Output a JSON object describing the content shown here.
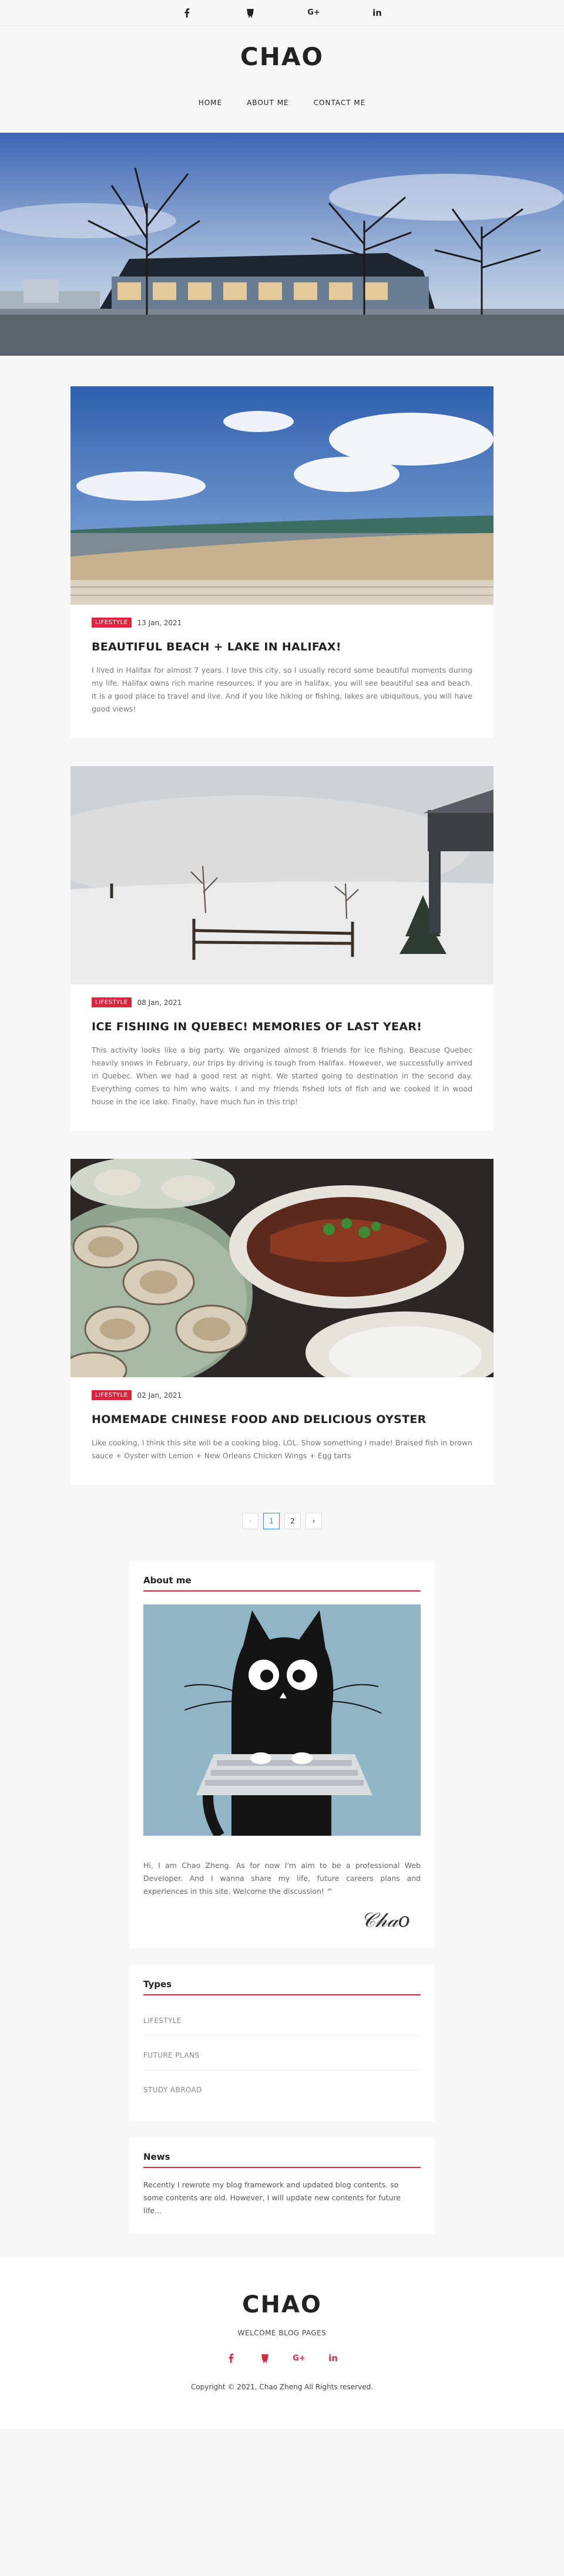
{
  "social": {
    "facebook_icon": "facebook-icon",
    "github_icon": "github-icon",
    "googleplus_icon": "google-plus-icon",
    "linkedin_icon": "linkedin-icon",
    "googleplus_text": "G+",
    "linkedin_text": "in"
  },
  "header": {
    "brand": "CHAO",
    "nav": [
      "HOME",
      "ABOUT ME",
      "CONTACT ME"
    ]
  },
  "posts": [
    {
      "category": "LIFESTYLE",
      "date": "13 Jan, 2021",
      "title": "BEAUTIFUL BEACH + LAKE IN HALIFAX!",
      "excerpt": "I lived in Halifax for almost 7 years. I love this city, so I usually record some beautiful moments during my life. Halifax owns rich marine resources, if you are in halifax, you will see beautiful sea and beach. It is a good place to travel and live. And if you like hiking or fishing, lakes are ubiquitous, you will have good views!"
    },
    {
      "category": "LIFESTYLE",
      "date": "08 Jan, 2021",
      "title": "ICE FISHING IN QUEBEC! MEMORIES OF LAST YEAR!",
      "excerpt": "This activity looks like a big party. We organized almost 8 friends for ice fishing. Beacuse Quebec heavily snows in February, our trips by driving is tough from Halifax. However, we successfully arrived in Quebec. When we had a good rest at night. We started going to destination in the second day. Everything comes to him who waits. I and my friends fished lots of fish and we cooked it in wood house in the ice lake. Finally, have much fun in this trip!"
    },
    {
      "category": "LIFESTYLE",
      "date": "02 Jan, 2021",
      "title": "HOMEMADE CHINESE FOOD AND DELICIOUS OYSTER",
      "excerpt": "Like cooking, I think this site will be a cooking blog. LOL. Show something I made! Braised fish in brown sauce + Oyster with Lemon + New Orleans Chicken Wings + Egg tarts"
    }
  ],
  "pagination": {
    "prev": "‹",
    "pages": [
      "1",
      "2"
    ],
    "next": "›",
    "active": "1"
  },
  "about": {
    "title": "About me",
    "text": "Hi, I am Chao Zheng. As for now I'm aim to be a professional Web Developer. And I wanna share my life, future careers plans and experiences in this site. Welcome the discussion! ^",
    "signature": "Chao"
  },
  "types": {
    "title": "Types",
    "items": [
      "LIFESTYLE",
      "FUTURE PLANS",
      "STUDY ABROAD"
    ]
  },
  "news": {
    "title": "News",
    "text": "Recently I rewrote my blog framework and updated blog contents. so some contents are old. However, I will update new contents for future life..."
  },
  "footer": {
    "brand": "CHAO",
    "subtitle": "WELCOME BLOG PAGES",
    "copyright": "Copyright © 2021, Chao Zheng All Rights reserved."
  },
  "colors": {
    "accent": "#d7263d",
    "page_bg": "#f7f7f8",
    "link_active": "#3b82f6"
  }
}
